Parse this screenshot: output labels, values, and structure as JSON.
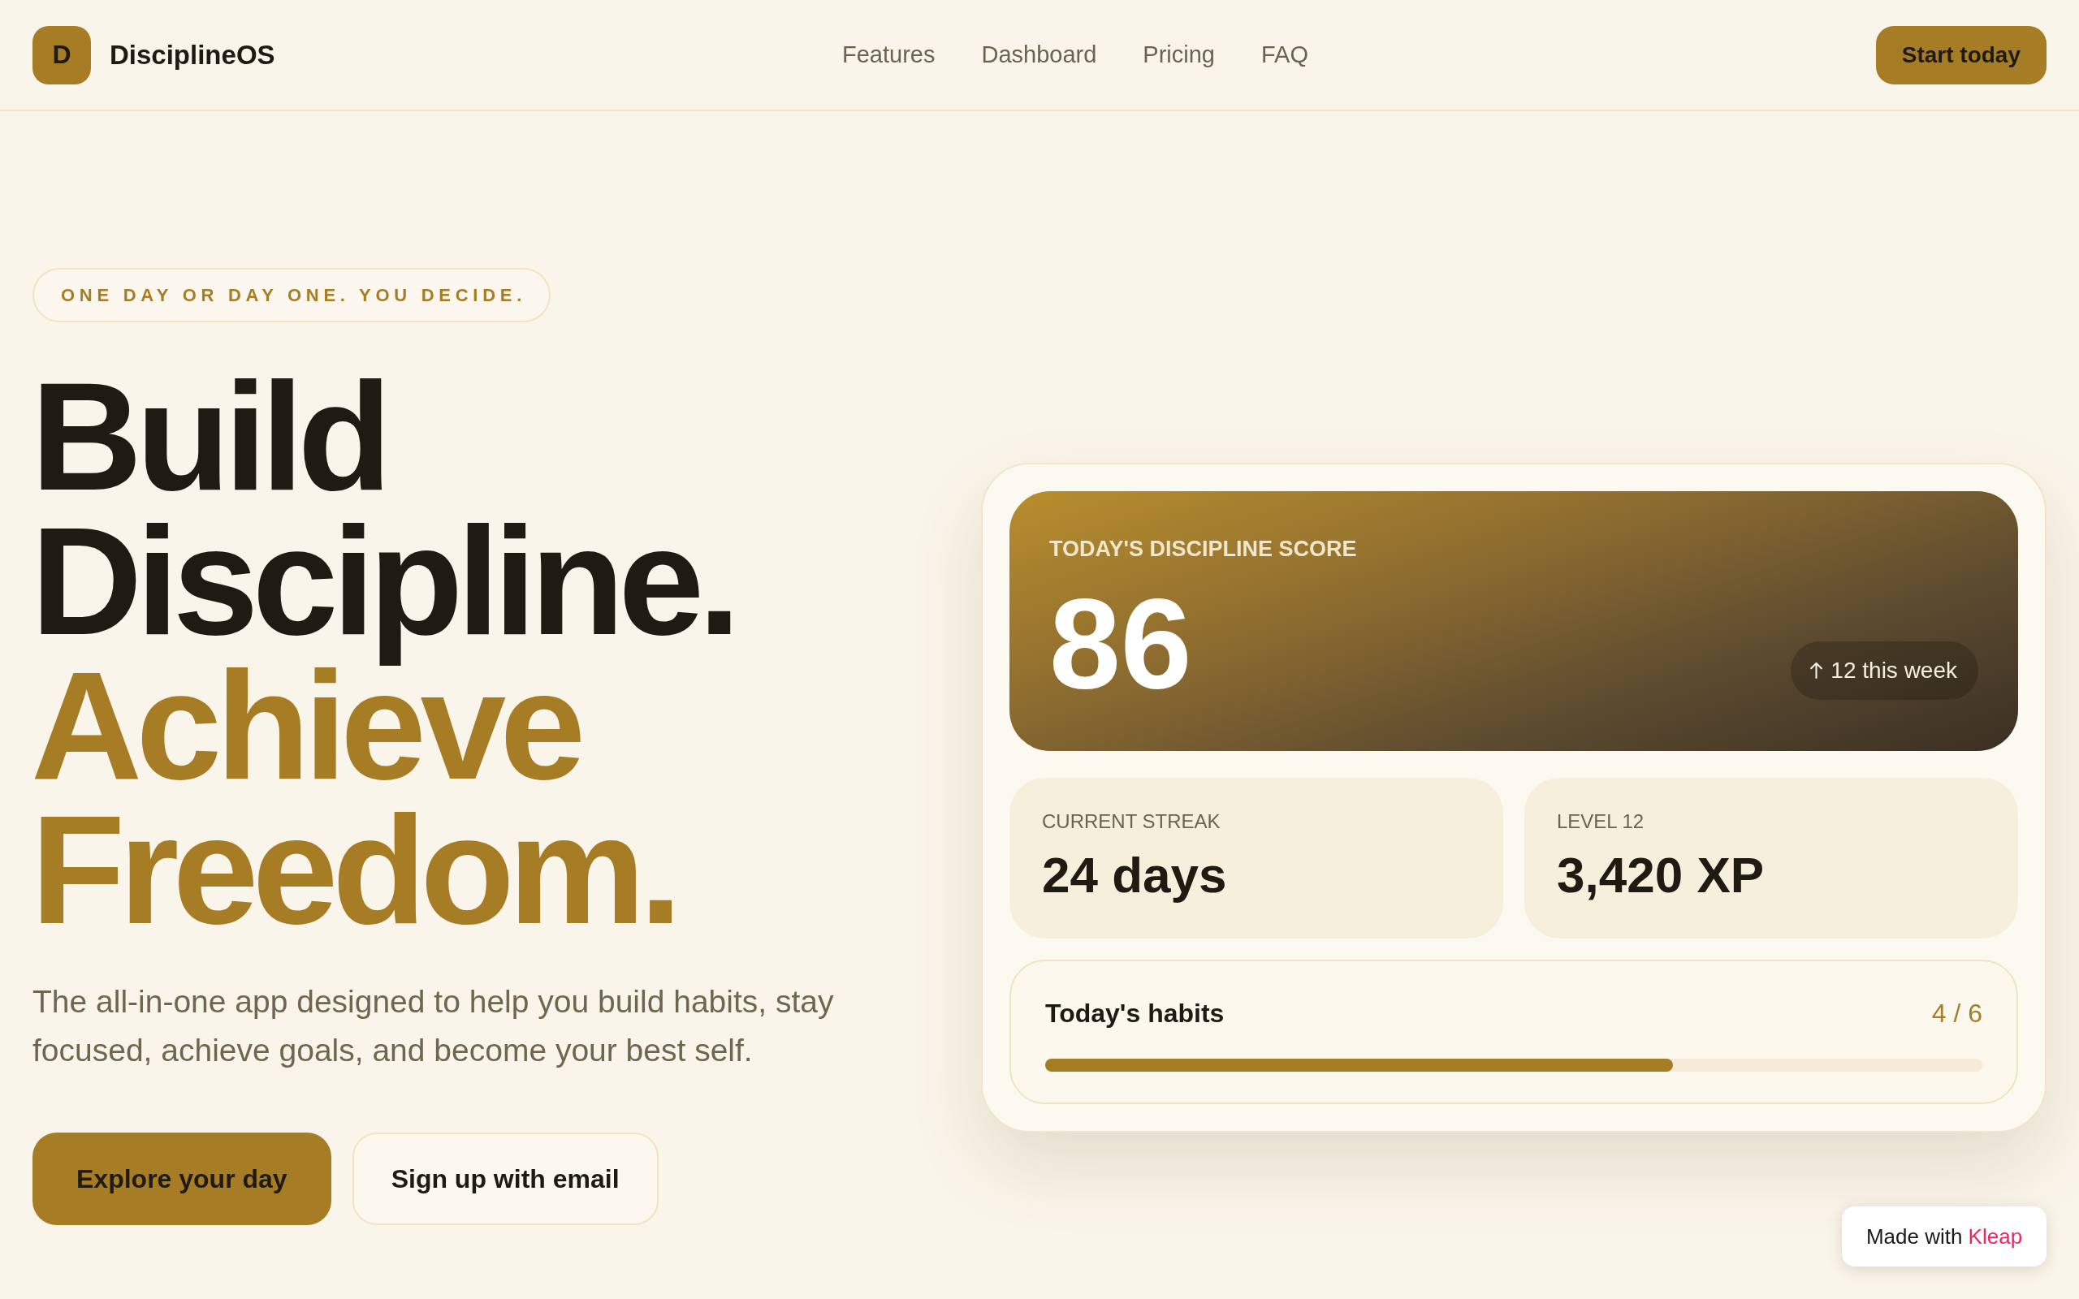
{
  "header": {
    "logo_letter": "D",
    "brand": "DisciplineOS",
    "nav": [
      {
        "label": "Features"
      },
      {
        "label": "Dashboard"
      },
      {
        "label": "Pricing"
      },
      {
        "label": "FAQ"
      }
    ],
    "cta": "Start today"
  },
  "hero": {
    "tagline": "ONE DAY OR DAY ONE. YOU DECIDE.",
    "headline": [
      {
        "text": "Build Discipline.",
        "kind": "dark"
      },
      {
        "text": "Achieve Freedom.",
        "kind": "accent"
      }
    ],
    "description": "The all-in-one app designed to help you build habits, stay focused, achieve goals, and become your best self.",
    "buttons": [
      {
        "label": "Explore your day",
        "kind": "primary"
      },
      {
        "label": "Sign up with email",
        "kind": "secondary"
      }
    ]
  },
  "dashboard_card": {
    "score": {
      "label": "TODAY'S DISCIPLINE SCORE",
      "value": "86",
      "trend": "12 this week"
    },
    "stats": [
      {
        "label": "CURRENT STREAK",
        "value": "24 days"
      },
      {
        "label": "LEVEL 12",
        "value": "3,420 XP"
      }
    ],
    "habits": {
      "title": "Today's habits",
      "count": "4 / 6",
      "level": 0.67
    }
  },
  "made_with_badge": {
    "text": "Made with",
    "brand": "Kleap"
  }
}
